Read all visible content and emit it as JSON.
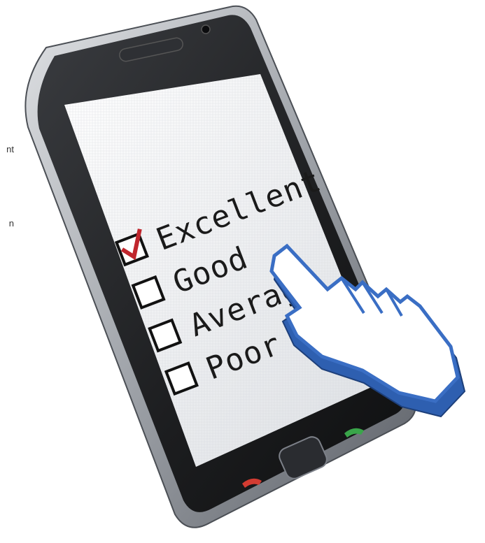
{
  "edge_fragments": [
    "nt",
    "n"
  ],
  "survey": {
    "options": [
      {
        "label": "Excellent",
        "checked": true
      },
      {
        "label": "Good",
        "checked": false
      },
      {
        "label": "Average",
        "checked": false
      },
      {
        "label": "Poor",
        "checked": false
      }
    ]
  },
  "colors": {
    "phone_bezel": "#1c1d1f",
    "phone_frame": "#b8bbbf",
    "screen": "#eef0f2",
    "check_mark": "#c0262d",
    "cursor_fill": "#ffffff",
    "cursor_outline": "#2e5fb0",
    "call_accept": "#3aa54a",
    "call_end": "#d33c32"
  },
  "icons": {
    "cursor": "pointing-hand-cursor-icon",
    "speaker": "earpiece-speaker-icon",
    "camera": "front-camera-icon",
    "home": "home-button-icon",
    "call_accept": "phone-accept-icon",
    "call_end": "phone-end-icon"
  }
}
